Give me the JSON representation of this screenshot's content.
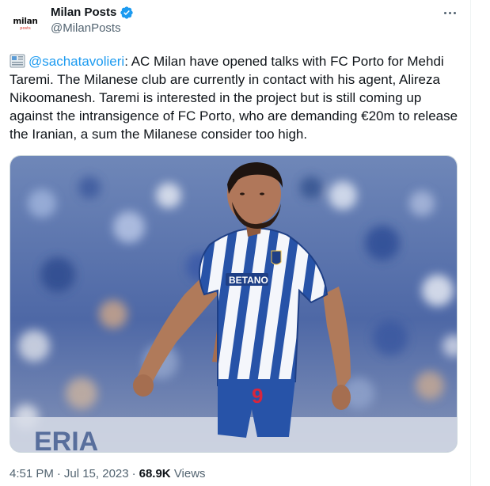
{
  "author": {
    "display_name": "Milan Posts",
    "handle": "@MilanPosts",
    "avatar_text": "milan",
    "avatar_subtext": "posts"
  },
  "tweet": {
    "mention": "@sachatavolieri",
    "text": ": AC Milan have opened talks with FC Porto for Mehdi Taremi. The Milanese club are currently in contact with his agent, Alireza Nikoomanesh. Taremi is interested in the project but is still coming up against the intransigence of FC Porto, who are demanding €20m to release the Iranian, a sum the Milanese consider too high."
  },
  "media": {
    "sponsor_text": "BETANO",
    "shirt_number": "9",
    "banner_text": "ERIA"
  },
  "meta": {
    "time": "4:51 PM",
    "separator": "·",
    "date": "Jul 15, 2023",
    "views_count": "68.9K",
    "views_label": "Views"
  },
  "colors": {
    "accent": "#1d9bf0",
    "text_primary": "#0f1419",
    "text_secondary": "#536471",
    "border": "#cfd9de"
  },
  "icons": {
    "verified": "verified-badge-icon",
    "more": "more-options-icon",
    "news": "newspaper-emoji-icon"
  }
}
